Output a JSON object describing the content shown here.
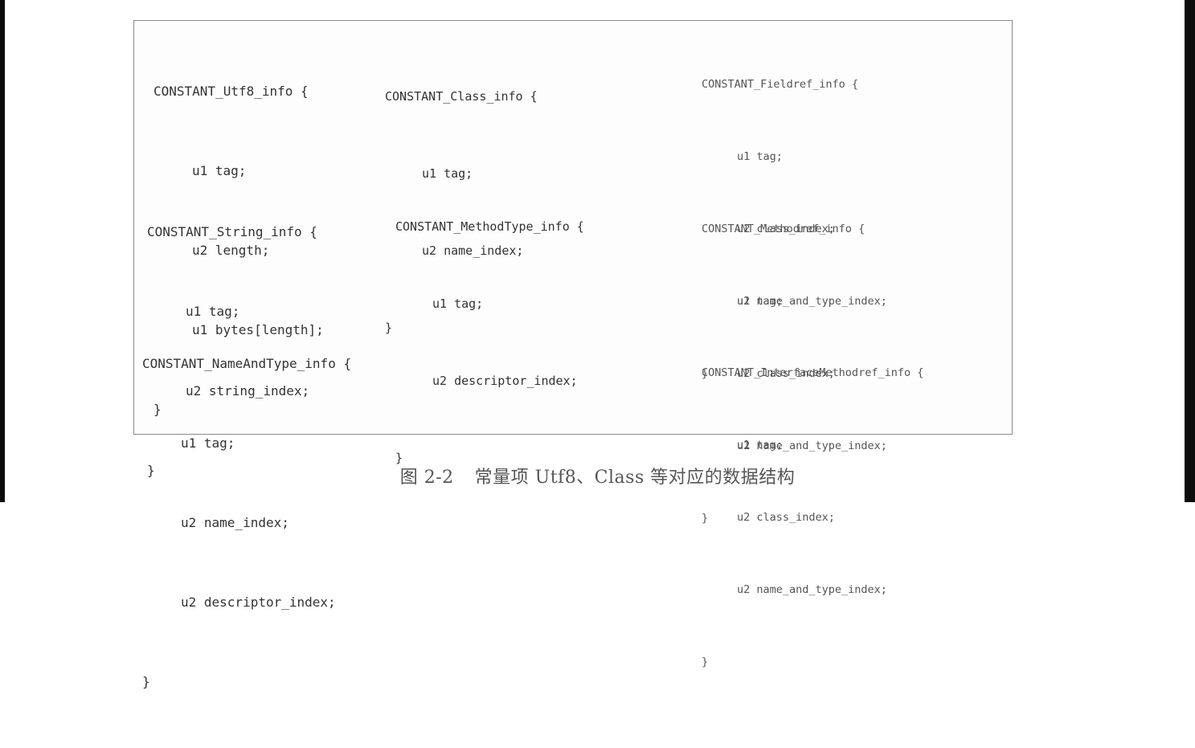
{
  "structures": {
    "utf8": {
      "header": "CONSTANT_Utf8_info {",
      "fields": [
        "u1 tag;",
        "u2 length;",
        "u1 bytes[length];"
      ],
      "close": "}"
    },
    "class": {
      "header": "CONSTANT_Class_info {",
      "fields": [
        "u1 tag;",
        "u2 name_index;"
      ],
      "close": "}"
    },
    "fieldref": {
      "header": "CONSTANT_Fieldref_info {",
      "fields": [
        "u1 tag;",
        "u2 class_index;",
        "u2 name_and_type_index;"
      ],
      "close": "}"
    },
    "string": {
      "header": "CONSTANT_String_info {",
      "fields": [
        "u1 tag;",
        "u2 string_index;"
      ],
      "close": "}"
    },
    "methodtype": {
      "header": "CONSTANT_MethodType_info {",
      "fields": [
        "u1 tag;",
        "u2 descriptor_index;"
      ],
      "close": "}"
    },
    "methodref": {
      "header": "CONSTANT_Methodref_info {",
      "fields": [
        "u1 tag;",
        "u2 class_index;",
        "u2 name_and_type_index;"
      ],
      "close": "}"
    },
    "nameandtype": {
      "header": "CONSTANT_NameAndType_info {",
      "fields": [
        "u1 tag;",
        "u2 name_index;",
        "u2 descriptor_index;"
      ],
      "close": "}"
    },
    "interfacemethodref": {
      "header": "CONSTANT_InterfaceMethodref_info {",
      "fields": [
        "u1 tag;",
        "u2 class_index;",
        "u2 name_and_type_index;"
      ],
      "close": "}"
    }
  },
  "caption": {
    "number": "图 2-2",
    "text": "常量项 Utf8、Class 等对应的数据结构"
  }
}
